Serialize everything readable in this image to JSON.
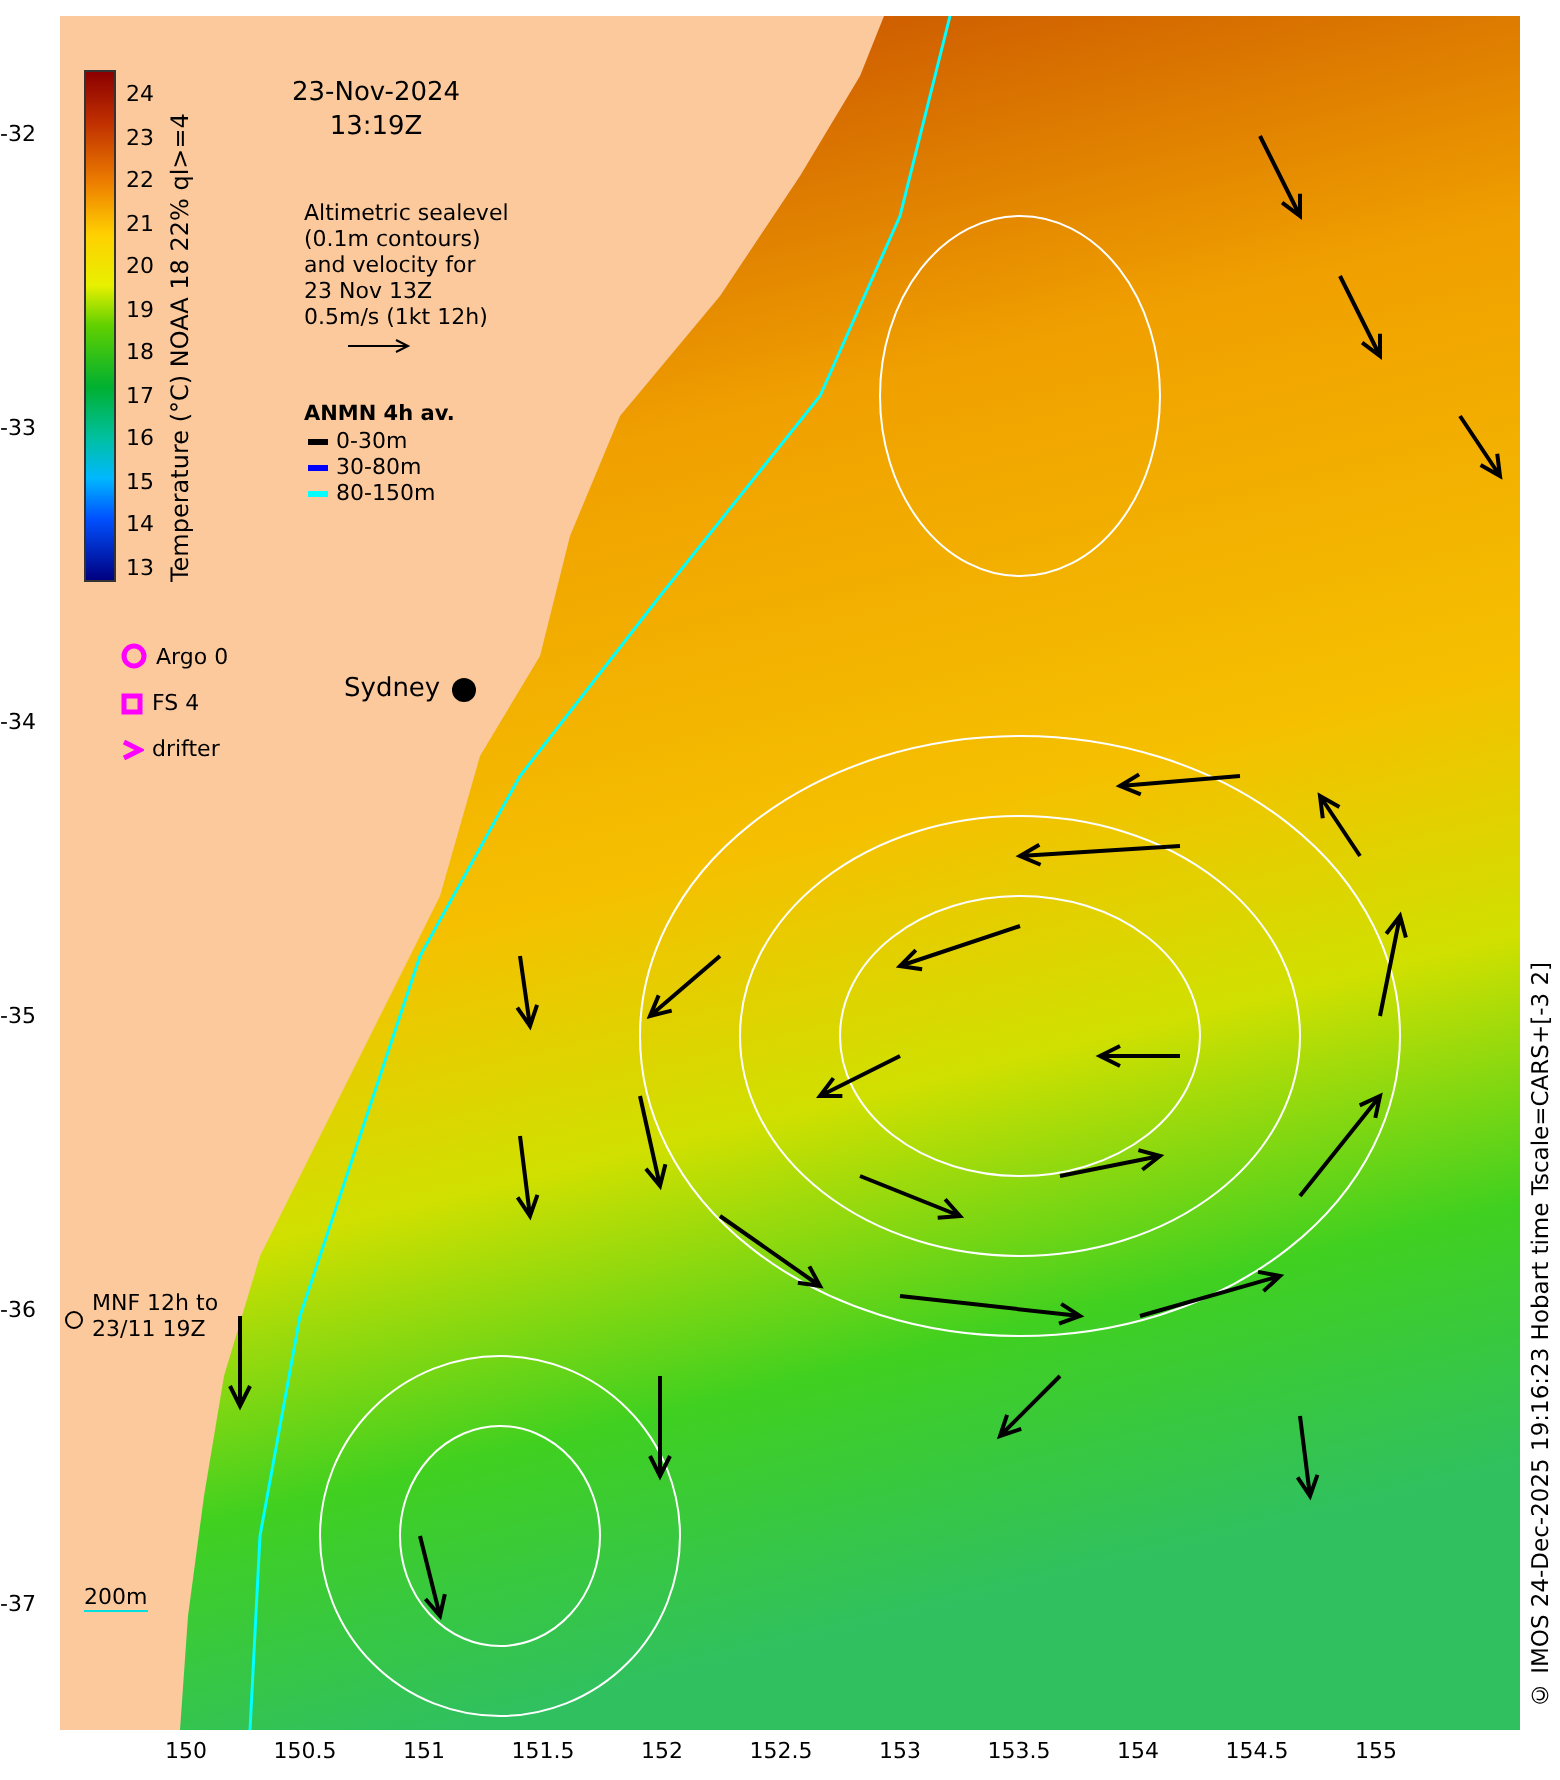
{
  "map": {
    "date": "23-Nov-2024",
    "time": "13:19Z",
    "altimetry_note": [
      "Altimetric sealevel",
      "(0.1m contours)",
      "and velocity for",
      "23 Nov 13Z",
      "0.5m/s (1kt 12h)"
    ],
    "colorbar": {
      "label": "Temperature (°C) NOAA 18 22% ql>=4",
      "ticks": [
        "24",
        "23",
        "22",
        "21",
        "20",
        "19",
        "18",
        "17",
        "16",
        "15",
        "14",
        "13"
      ]
    },
    "anmn": {
      "title": "ANMN 4h av.",
      "items": [
        {
          "label": "0-30m",
          "color": "#000000"
        },
        {
          "label": "30-80m",
          "color": "#0000ff"
        },
        {
          "label": "80-150m",
          "color": "#00ffff"
        }
      ]
    },
    "legend": [
      {
        "kind": "circle",
        "label": "Argo 0"
      },
      {
        "kind": "square",
        "label": "FS 4"
      },
      {
        "kind": "chevron",
        "label": "drifter"
      }
    ],
    "city": "Sydney",
    "mooring_note": [
      "MNF 12h to",
      "23/11 19Z"
    ],
    "depth_label": "200m"
  },
  "y_axis": {
    "ticks": [
      "-32",
      "-33",
      "-34",
      "-35",
      "-36",
      "-37"
    ]
  },
  "x_axis": {
    "ticks": [
      "150",
      "150.5",
      "151",
      "151.5",
      "152",
      "152.5",
      "153",
      "153.5",
      "154",
      "154.5",
      "155"
    ]
  },
  "credit": "© IMOS 24-Dec-2025 19:16:23 Hobart time Tscale=CARS+[-3 2]"
}
